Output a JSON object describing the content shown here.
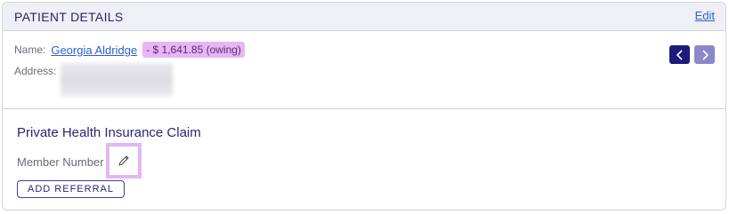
{
  "header": {
    "title": "PATIENT DETAILS",
    "edit_label": "Edit"
  },
  "patient": {
    "name_label": "Name:",
    "name": "Georgia Aldridge",
    "balance_badge": "- $ 1,641.85 (owing)",
    "address_label": "Address:"
  },
  "navigation": {
    "prev_icon": "chevron-left-icon",
    "next_icon": "chevron-right-icon"
  },
  "claim": {
    "title": "Private Health Insurance Claim",
    "member_number_label": "Member Number",
    "edit_icon": "pencil-icon",
    "add_referral_label": "ADD REFERRAL"
  },
  "colors": {
    "accent": "#1f1a7a",
    "badge_bg": "#e8b6f5",
    "highlight_border": "#e3b7f3",
    "link": "#2f5fc8"
  }
}
